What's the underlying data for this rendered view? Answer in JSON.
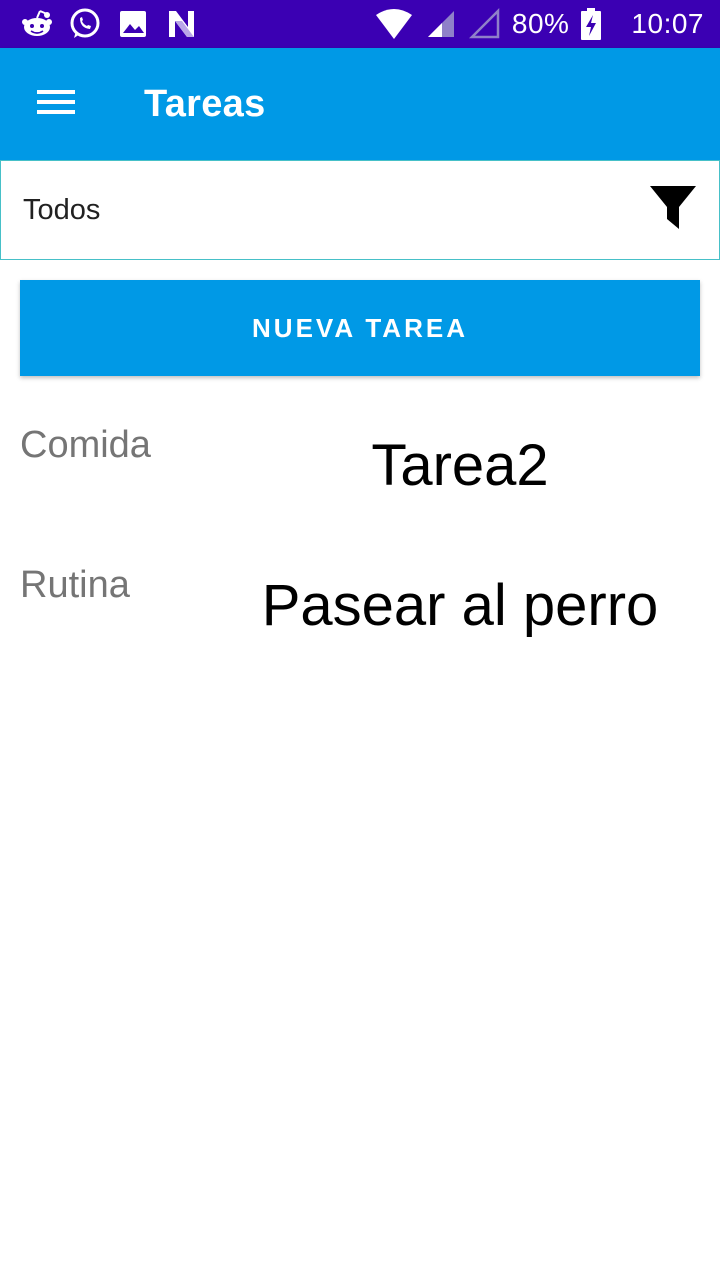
{
  "status_bar": {
    "battery": "80%",
    "time": "10:07",
    "icons": [
      "reddit-icon",
      "whatsapp-icon",
      "image-icon",
      "n-icon",
      "wifi-icon",
      "signal-icon",
      "signal-empty-icon",
      "battery-charging-icon"
    ]
  },
  "app_bar": {
    "title": "Tareas",
    "color": "#0099e6"
  },
  "filter": {
    "value": "Todos",
    "icon": "filter-icon"
  },
  "new_task_button": {
    "label": "NUEVA TAREA"
  },
  "tasks": [
    {
      "category": "Comida",
      "name": "Tarea2"
    },
    {
      "category": "Rutina",
      "name": "Pasear al perro"
    }
  ],
  "colors": {
    "status_bar": "#3b00b3",
    "primary": "#0099e6",
    "category_text": "#757575",
    "filter_border": "#46c0c8"
  }
}
